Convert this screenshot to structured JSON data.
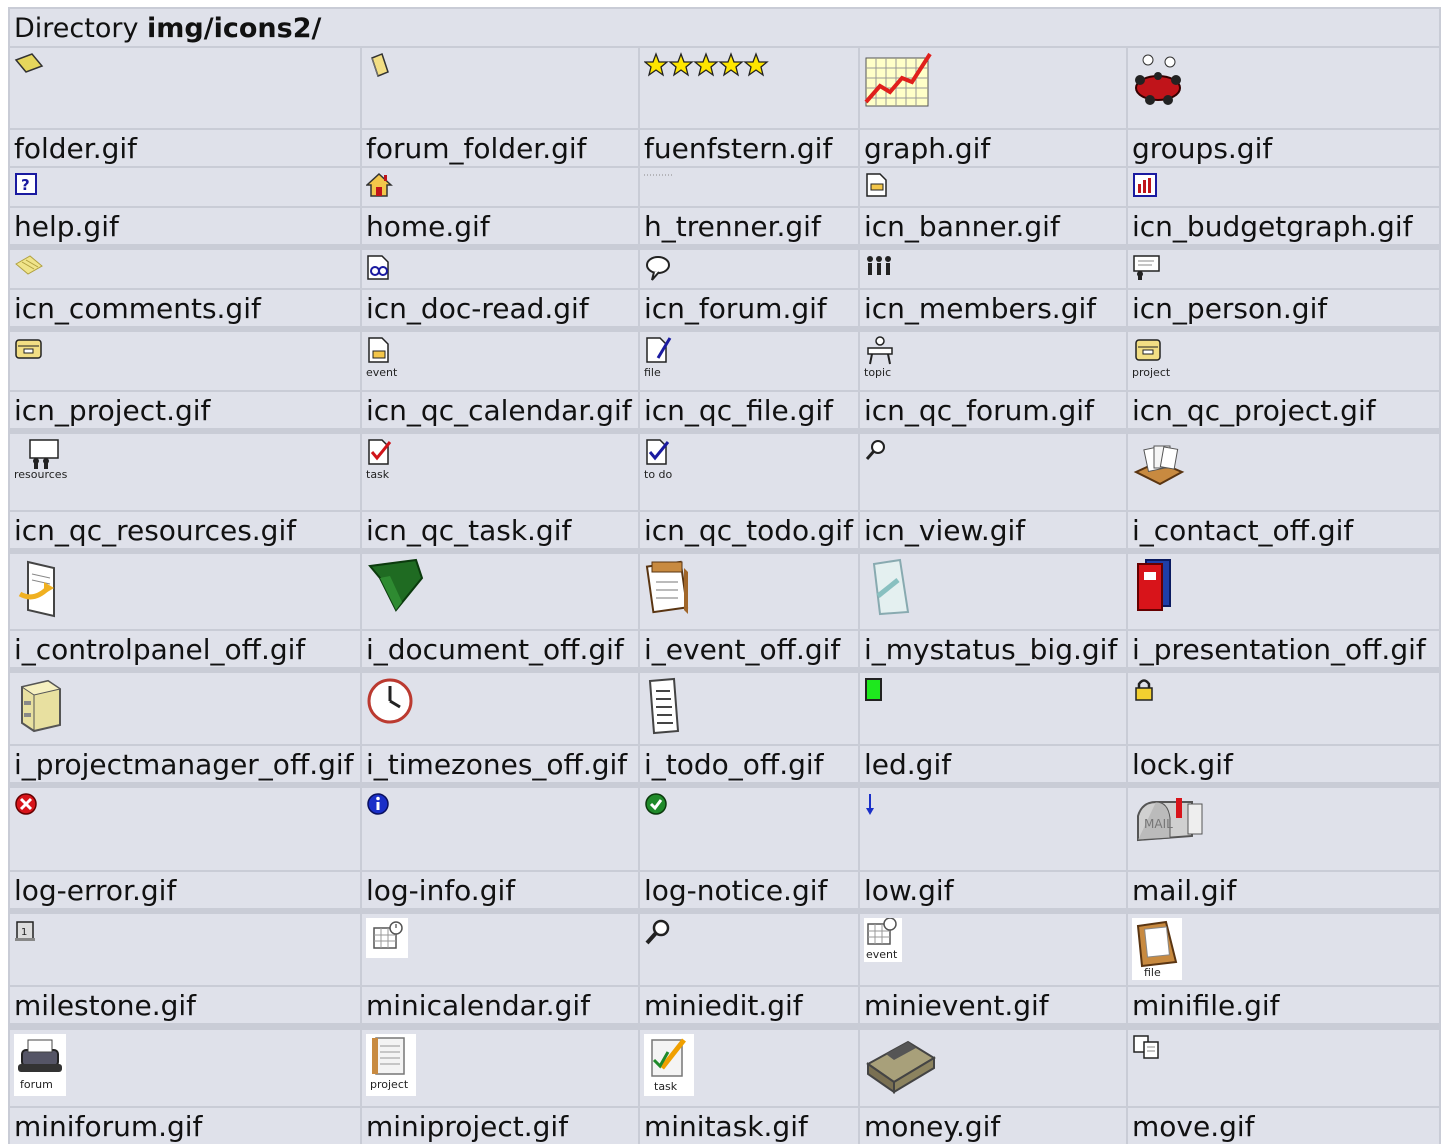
{
  "header": {
    "prefix": "Directory",
    "path": "img/icons2/"
  },
  "rows": [
    [
      {
        "label": "folder.gif",
        "icon": "folder-icon"
      },
      {
        "label": "forum_folder.gif",
        "icon": "forum-folder-icon"
      },
      {
        "label": "fuenfstern.gif",
        "icon": "five-stars-icon"
      },
      {
        "label": "graph.gif",
        "icon": "graph-icon"
      },
      {
        "label": "groups.gif",
        "icon": "groups-icon"
      }
    ],
    [
      {
        "label": "help.gif",
        "icon": "help-icon"
      },
      {
        "label": "home.gif",
        "icon": "home-icon"
      },
      {
        "label": "h_trenner.gif",
        "icon": "h-separator-icon"
      },
      {
        "label": "icn_banner.gif",
        "icon": "banner-icon"
      },
      {
        "label": "icn_budgetgraph.gif",
        "icon": "budget-graph-icon"
      }
    ],
    [
      {
        "label": "icn_comments.gif",
        "icon": "comments-icon"
      },
      {
        "label": "icn_doc-read.gif",
        "icon": "doc-read-icon"
      },
      {
        "label": "icn_forum.gif",
        "icon": "forum-bubble-icon"
      },
      {
        "label": "icn_members.gif",
        "icon": "members-icon"
      },
      {
        "label": "icn_person.gif",
        "icon": "person-icon"
      }
    ],
    [
      {
        "label": "icn_project.gif",
        "icon": "project-box-icon"
      },
      {
        "label": "icn_qc_calendar.gif",
        "icon": "qc-calendar-icon",
        "caption": "event"
      },
      {
        "label": "icn_qc_file.gif",
        "icon": "qc-file-icon",
        "caption": "file"
      },
      {
        "label": "icn_qc_forum.gif",
        "icon": "qc-forum-icon",
        "caption": "topic"
      },
      {
        "label": "icn_qc_project.gif",
        "icon": "qc-project-icon",
        "caption": "project"
      }
    ],
    [
      {
        "label": "icn_qc_resources.gif",
        "icon": "qc-resources-icon",
        "caption": "resources"
      },
      {
        "label": "icn_qc_task.gif",
        "icon": "qc-task-icon",
        "caption": "task"
      },
      {
        "label": "icn_qc_todo.gif",
        "icon": "qc-todo-icon",
        "caption": "to do"
      },
      {
        "label": "icn_view.gif",
        "icon": "view-magnifier-icon"
      },
      {
        "label": "i_contact_off.gif",
        "icon": "contact-cards-icon"
      }
    ],
    [
      {
        "label": "i_controlpanel_off.gif",
        "icon": "control-panel-icon"
      },
      {
        "label": "i_document_off.gif",
        "icon": "document-folder-icon"
      },
      {
        "label": "i_event_off.gif",
        "icon": "event-calendar-icon"
      },
      {
        "label": "i_mystatus_big.gif",
        "icon": "mystatus-icon"
      },
      {
        "label": "i_presentation_off.gif",
        "icon": "presentation-binders-icon"
      }
    ],
    [
      {
        "label": "i_projectmanager_off.gif",
        "icon": "cabinet-icon"
      },
      {
        "label": "i_timezones_off.gif",
        "icon": "clock-icon"
      },
      {
        "label": "i_todo_off.gif",
        "icon": "todo-list-icon"
      },
      {
        "label": "led.gif",
        "icon": "led-icon"
      },
      {
        "label": "lock.gif",
        "icon": "lock-icon"
      }
    ],
    [
      {
        "label": "log-error.gif",
        "icon": "error-icon"
      },
      {
        "label": "log-info.gif",
        "icon": "info-icon"
      },
      {
        "label": "log-notice.gif",
        "icon": "notice-check-icon"
      },
      {
        "label": "low.gif",
        "icon": "arrow-down-icon"
      },
      {
        "label": "mail.gif",
        "icon": "mailbox-icon"
      }
    ],
    [
      {
        "label": "milestone.gif",
        "icon": "milestone-icon"
      },
      {
        "label": "minicalendar.gif",
        "icon": "mini-calendar-icon"
      },
      {
        "label": "miniedit.gif",
        "icon": "mini-edit-magnifier-icon"
      },
      {
        "label": "minievent.gif",
        "icon": "mini-event-icon",
        "caption": "event"
      },
      {
        "label": "minifile.gif",
        "icon": "mini-file-icon",
        "caption": "file"
      }
    ],
    [
      {
        "label": "miniforum.gif",
        "icon": "mini-forum-typewriter-icon",
        "caption": "forum"
      },
      {
        "label": "miniproject.gif",
        "icon": "mini-project-icon",
        "caption": "project"
      },
      {
        "label": "minitask.gif",
        "icon": "mini-task-icon",
        "caption": "task"
      },
      {
        "label": "money.gif",
        "icon": "money-icon"
      },
      {
        "label": "move.gif",
        "icon": "move-icon"
      }
    ]
  ]
}
